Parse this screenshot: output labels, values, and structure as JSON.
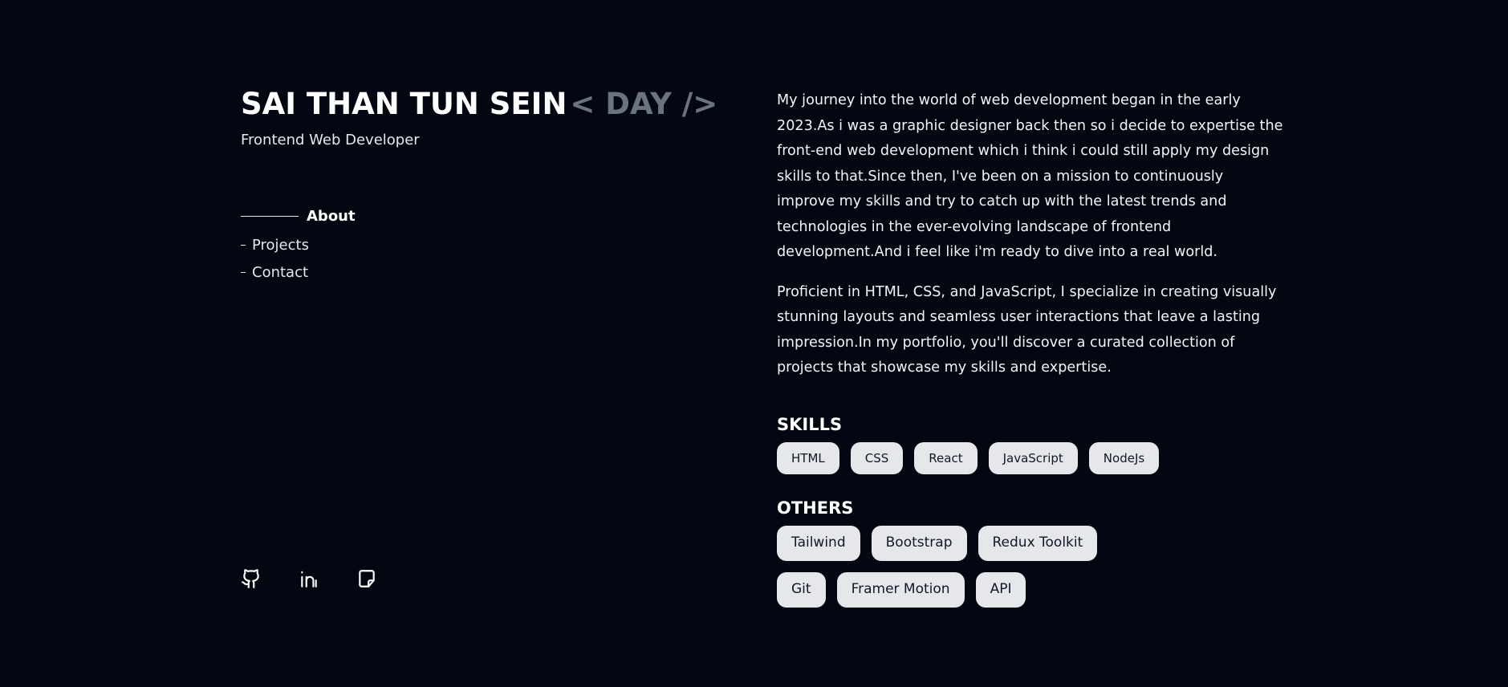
{
  "profile": {
    "name": "SAI THAN TUN SEIN",
    "tag": "< DAY />",
    "subtitle": "Frontend Web Developer"
  },
  "nav": {
    "items": [
      {
        "label": "About",
        "active": true
      },
      {
        "label": "Projects",
        "active": false
      },
      {
        "label": "Contact",
        "active": false
      }
    ]
  },
  "socials": {
    "icons": [
      "github-icon",
      "linkedin-icon",
      "document-icon"
    ]
  },
  "about": {
    "paragraphs": [
      "My journey into the world of web development began in the early 2023.As i was a graphic designer back then so i decide to expertise the front-end web development which i think i could still apply my design skills to that.Since then, I've been on a mission to continuously improve my skills and try to catch up with the latest trends and technologies in the ever-evolving landscape of frontend development.And i feel like i'm ready to dive into a real world.",
      "Proficient in HTML, CSS, and JavaScript, I specialize in creating visually stunning layouts and seamless user interactions that leave a lasting impression.In my portfolio, you'll discover a curated collection of projects that showcase my skills and expertise."
    ]
  },
  "skills": {
    "title": "SKILLS",
    "items": [
      "HTML",
      "CSS",
      "React",
      "JavaScript",
      "NodeJs"
    ]
  },
  "others": {
    "title": "OTHERS",
    "items": [
      "Tailwind",
      "Bootstrap",
      "Redux Toolkit",
      "Git",
      "Framer Motion",
      "API"
    ]
  },
  "colors": {
    "background": "#030712",
    "accent_muted": "#6b7280",
    "chip_bg": "#e5e7eb",
    "chip_text": "#111827"
  }
}
